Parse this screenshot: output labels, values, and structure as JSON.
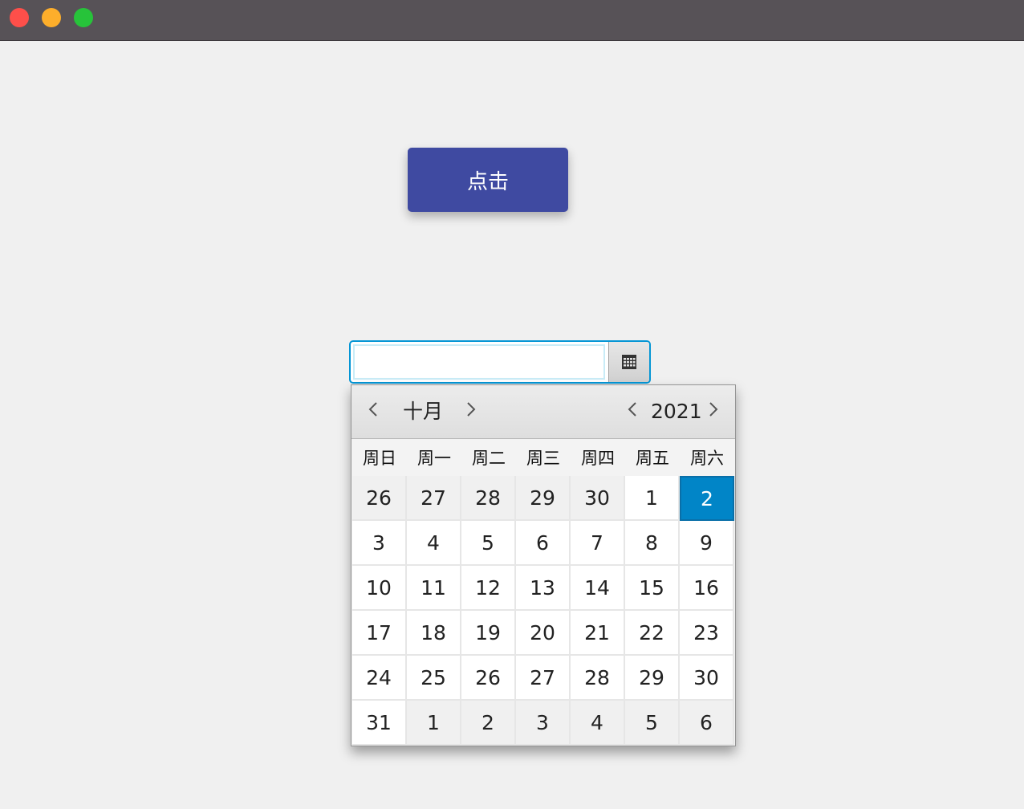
{
  "window": {
    "controls": [
      "close",
      "minimize",
      "maximize"
    ],
    "colors": {
      "close": "#fe4f4a",
      "minimize": "#fdae2b",
      "maximize": "#27c33a",
      "titlebar": "#575257"
    }
  },
  "main_button": {
    "label": "点击",
    "color": "#3f4aa1"
  },
  "date_picker": {
    "value": "",
    "button_icon": "calendar-icon",
    "accent": "#0596d5"
  },
  "calendar": {
    "month": "十月",
    "year": "2021",
    "prev_month_icon": "chevron-left-icon",
    "next_month_icon": "chevron-right-icon",
    "prev_year_icon": "chevron-left-icon",
    "next_year_icon": "chevron-right-icon",
    "weekdays": [
      "周日",
      "周一",
      "周二",
      "周三",
      "周四",
      "周五",
      "周六"
    ],
    "selected_color": "#0185c7",
    "weeks": [
      [
        {
          "d": "26",
          "other": true
        },
        {
          "d": "27",
          "other": true
        },
        {
          "d": "28",
          "other": true
        },
        {
          "d": "29",
          "other": true
        },
        {
          "d": "30",
          "other": true
        },
        {
          "d": "1"
        },
        {
          "d": "2",
          "selected": true
        }
      ],
      [
        {
          "d": "3"
        },
        {
          "d": "4"
        },
        {
          "d": "5"
        },
        {
          "d": "6"
        },
        {
          "d": "7"
        },
        {
          "d": "8"
        },
        {
          "d": "9"
        }
      ],
      [
        {
          "d": "10"
        },
        {
          "d": "11"
        },
        {
          "d": "12"
        },
        {
          "d": "13"
        },
        {
          "d": "14"
        },
        {
          "d": "15"
        },
        {
          "d": "16"
        }
      ],
      [
        {
          "d": "17"
        },
        {
          "d": "18"
        },
        {
          "d": "19"
        },
        {
          "d": "20"
        },
        {
          "d": "21"
        },
        {
          "d": "22"
        },
        {
          "d": "23"
        }
      ],
      [
        {
          "d": "24"
        },
        {
          "d": "25"
        },
        {
          "d": "26"
        },
        {
          "d": "27"
        },
        {
          "d": "28"
        },
        {
          "d": "29"
        },
        {
          "d": "30"
        }
      ],
      [
        {
          "d": "31"
        },
        {
          "d": "1",
          "other": true
        },
        {
          "d": "2",
          "other": true
        },
        {
          "d": "3",
          "other": true
        },
        {
          "d": "4",
          "other": true
        },
        {
          "d": "5",
          "other": true
        },
        {
          "d": "6",
          "other": true
        }
      ]
    ]
  }
}
